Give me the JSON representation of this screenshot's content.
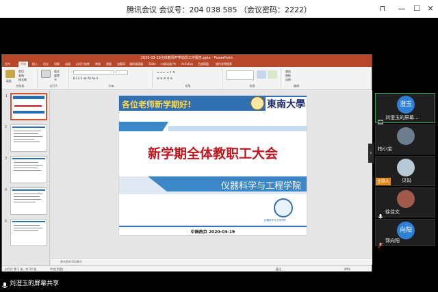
{
  "meeting": {
    "window_title": "腾讯会议  会议号：204 038 585 （会议密码：2222）",
    "share_label": "刘澄玉的屏幕共享"
  },
  "ppt": {
    "file_title": "2020-03-19全体教师开学动员工作报告.pptx - PowerPoint",
    "tabs": [
      "文件",
      "开始",
      "插入",
      "设计",
      "切换",
      "动画",
      "幻灯片放映",
      "审阅",
      "视图",
      "加载项",
      "福昕阅读器",
      "iSlide",
      "口袋动画 PA",
      "ActivExp",
      "百度网盘",
      "操作说明搜索"
    ],
    "ribbon_groups": [
      "剪贴板",
      "幻灯片",
      "字体",
      "段落",
      "绘图",
      "编辑"
    ],
    "ribbon": {
      "paste": "粘贴",
      "new_slide": "新建\n幻灯片",
      "cut": "剪切",
      "copy": "复制",
      "format_painter": "格式刷",
      "layout": "版式",
      "reset": "重置",
      "section": "节",
      "find": "查找",
      "replace": "替换",
      "select": "选择"
    },
    "notes_placeholder": "单击此处添加备注",
    "status": {
      "slide_info": "幻灯片 第 1 张，共 10 张",
      "lang": "中文(中国)",
      "notes": "备注",
      "zoom": "89%"
    },
    "thumbnail_numbers": [
      "1",
      "2",
      "3",
      "4",
      "5"
    ]
  },
  "slide": {
    "greeting": "各位老师新学期好!",
    "university": "東南大學",
    "main_title": "新学期全体教职工大会",
    "department": "仪器科学与工程学院",
    "logo_caption": "仪器科学与工程学院",
    "footer": "中国南京  2020-03-19"
  },
  "participants": [
    {
      "name": "刘澄玉的屏幕...",
      "avatar_text": "澄玉",
      "avatar_color": "#2f7fd6",
      "speaking": true,
      "host": false
    },
    {
      "name": "柏小宝",
      "avatar_text": "",
      "avatar_color": "#6d7f8e",
      "speaking": false,
      "host": false
    },
    {
      "name": "贝妈",
      "avatar_text": "",
      "avatar_color": "#b8c9d6",
      "speaking": false,
      "host": true
    },
    {
      "name": "徐佳文",
      "avatar_text": "",
      "avatar_color": "#a25b4a",
      "speaking": false,
      "host": false
    },
    {
      "name": "郭向阳",
      "avatar_text": "向阳",
      "avatar_color": "#2f7fd6",
      "speaking": false,
      "host": false
    }
  ],
  "host_tag": "主持人",
  "colors": {
    "ppt_accent": "#b7472a",
    "slide_blue": "#2f6fb2",
    "title_red": "#c0141e",
    "greeting_yellow": "#ffd84a"
  }
}
